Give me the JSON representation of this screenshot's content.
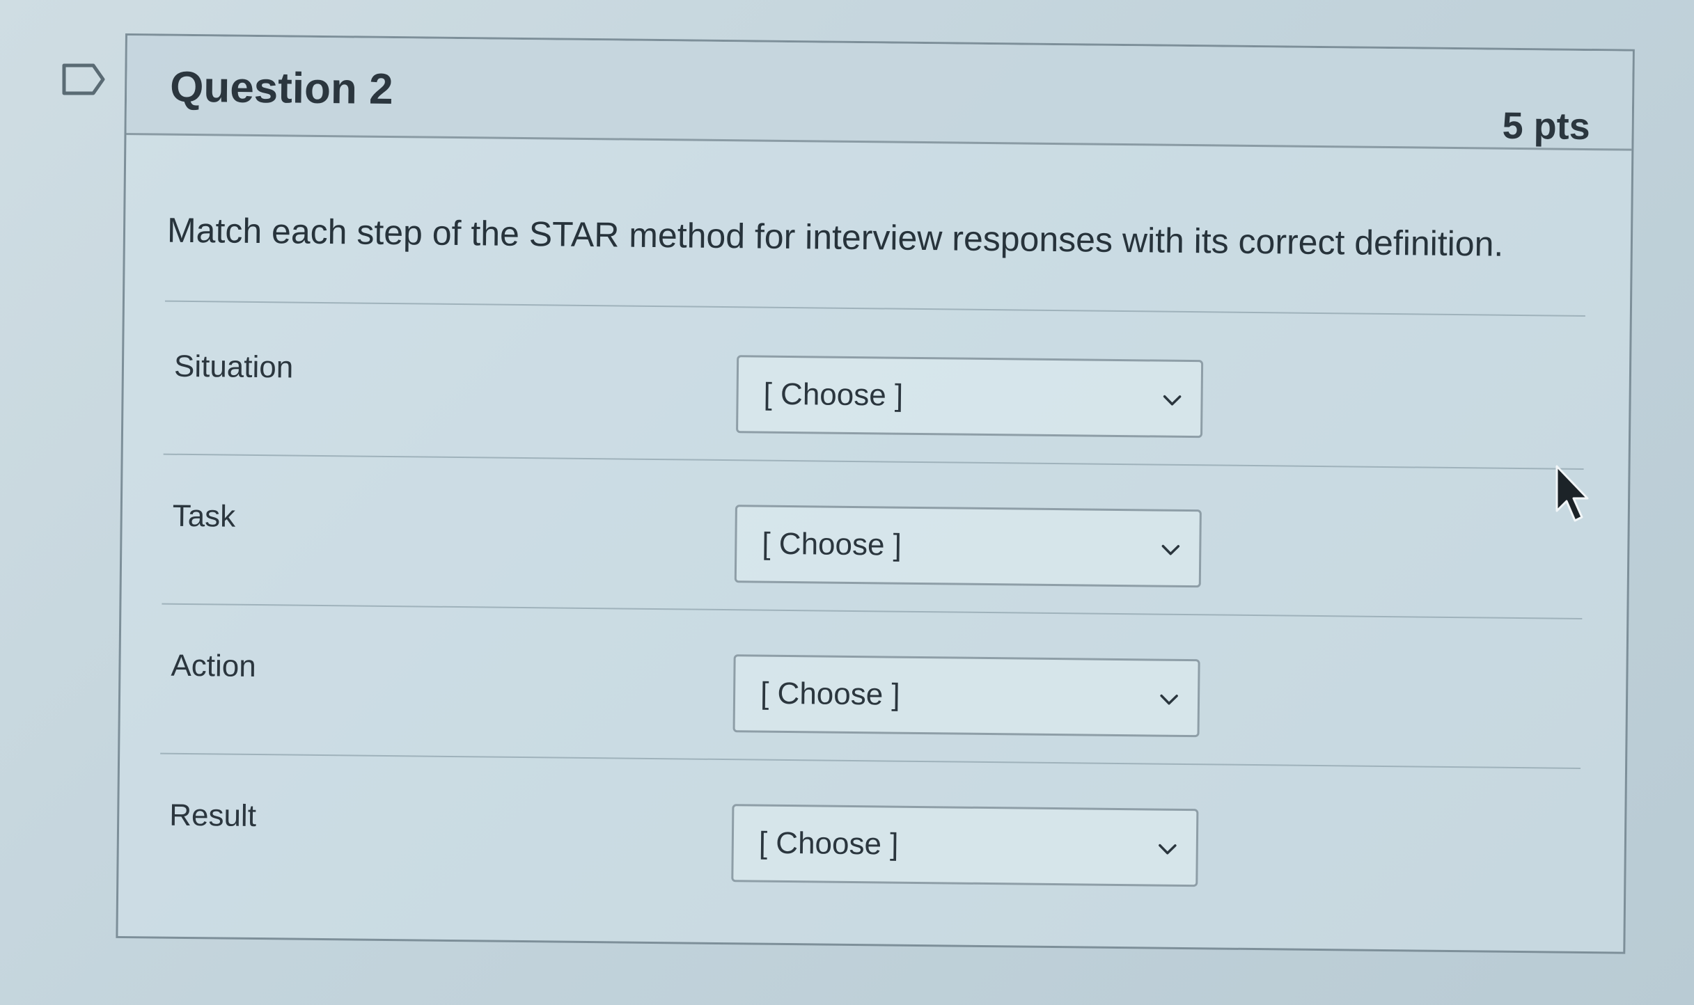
{
  "question": {
    "title": "Question 2",
    "points": "5 pts",
    "prompt": "Match each step of the STAR method for interview responses with its correct definition."
  },
  "rows": [
    {
      "label": "Situation",
      "select_value": "[ Choose ]"
    },
    {
      "label": "Task",
      "select_value": "[ Choose ]"
    },
    {
      "label": "Action",
      "select_value": "[ Choose ]"
    },
    {
      "label": "Result",
      "select_value": "[ Choose ]"
    }
  ],
  "icons": {
    "flag": "flag-icon",
    "dropdown": "chevron-down-icon",
    "cursor": "mouse-cursor-icon"
  },
  "colors": {
    "border": "#7d8f99",
    "text": "#2b363e",
    "background": "#c7d8df"
  }
}
